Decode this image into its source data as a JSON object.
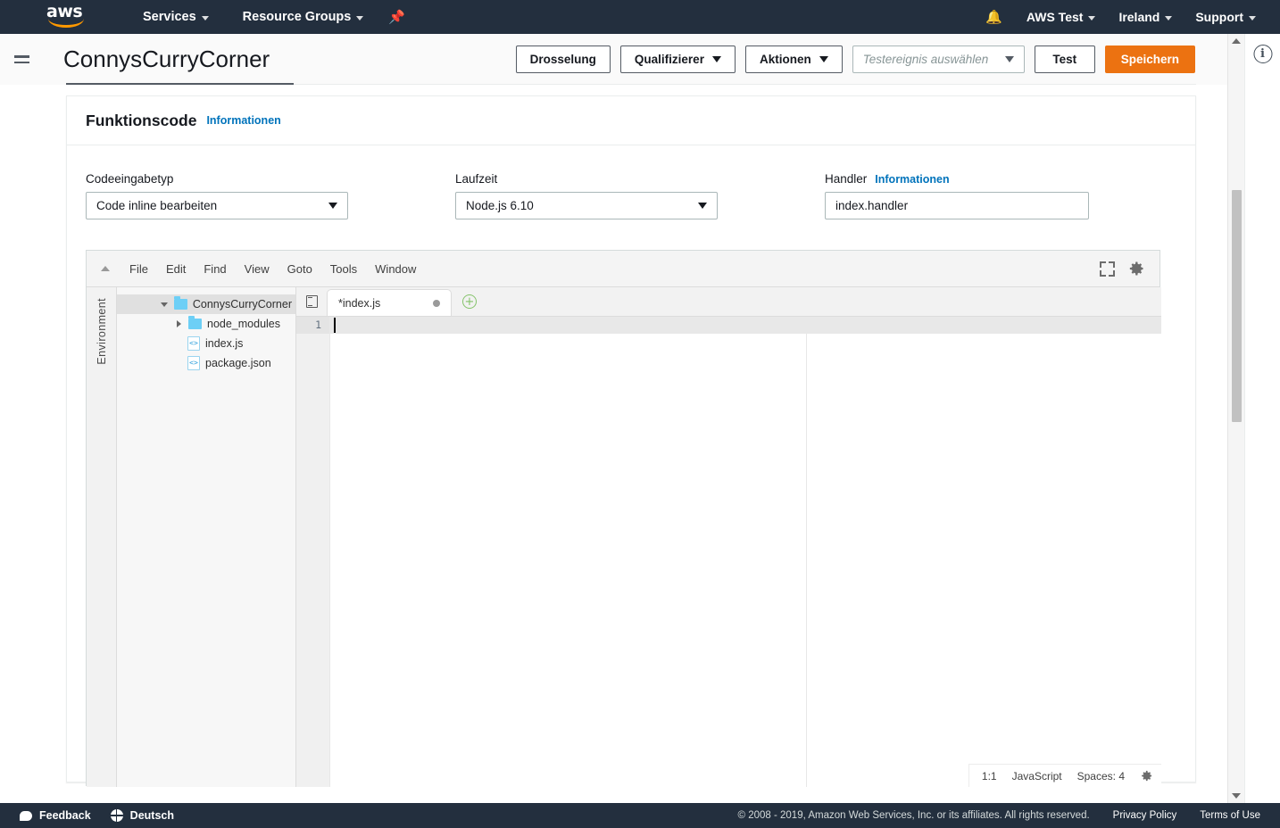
{
  "topnav": {
    "logo": "aws-logo",
    "services": "Services",
    "resource_groups": "Resource Groups",
    "pin_icon": "pin-icon",
    "bell_icon": "bell-icon",
    "account": "AWS Test",
    "region": "Ireland",
    "support": "Support"
  },
  "header": {
    "menu_icon": "hamburger-icon",
    "title": "ConnysCurryCorner",
    "buttons": {
      "throttle": "Drosselung",
      "qualifier": "Qualifizierer",
      "actions": "Aktionen",
      "test": "Test",
      "save": "Speichern"
    },
    "test_event_placeholder": "Testereignis auswählen"
  },
  "card": {
    "title": "Funktionscode",
    "info_link": "Informationen"
  },
  "form": {
    "code_entry_type": {
      "label": "Codeeingabetyp",
      "value": "Code inline bearbeiten"
    },
    "runtime": {
      "label": "Laufzeit",
      "value": "Node.js 6.10"
    },
    "handler": {
      "label": "Handler",
      "info_link": "Informationen",
      "value": "index.handler"
    }
  },
  "editor": {
    "menu": [
      "File",
      "Edit",
      "Find",
      "View",
      "Goto",
      "Tools",
      "Window"
    ],
    "expand_icon": "expand-icon",
    "settings_icon": "gear-icon",
    "env_rail_label": "Environment",
    "tree": [
      {
        "label": "ConnysCurryCorner",
        "type": "folder",
        "state": "expanded",
        "depth": 0,
        "selected": true
      },
      {
        "label": "node_modules",
        "type": "folder",
        "state": "collapsed",
        "depth": 1,
        "selected": false
      },
      {
        "label": "index.js",
        "type": "file",
        "state": "",
        "depth": 1,
        "selected": false
      },
      {
        "label": "package.json",
        "type": "file",
        "state": "",
        "depth": 1,
        "selected": false
      }
    ],
    "tree_toggle_icon": "panel-toggle-icon",
    "tab": {
      "label": "*index.js",
      "modified_icon": "unsaved-dot-icon"
    },
    "add_tab": "+",
    "line_numbers": [
      "1"
    ],
    "code_lines": [
      ""
    ],
    "status": {
      "cursor": "1:1",
      "language": "JavaScript",
      "indent": "Spaces: 4",
      "settings_icon": "gear-icon"
    }
  },
  "right_rail": {
    "info_icon": "info-icon",
    "scroll_up_icon": "scroll-up-arrow",
    "scroll_down_icon": "scroll-down-arrow"
  },
  "footer": {
    "feedback": "Feedback",
    "language": "Deutsch",
    "copyright": "© 2008 - 2019, Amazon Web Services, Inc. or its affiliates. All rights reserved.",
    "privacy": "Privacy Policy",
    "terms": "Terms of Use"
  },
  "colors": {
    "nav_bg": "#232f3e",
    "accent_orange": "#ec7211",
    "link_blue": "#0073bb"
  }
}
